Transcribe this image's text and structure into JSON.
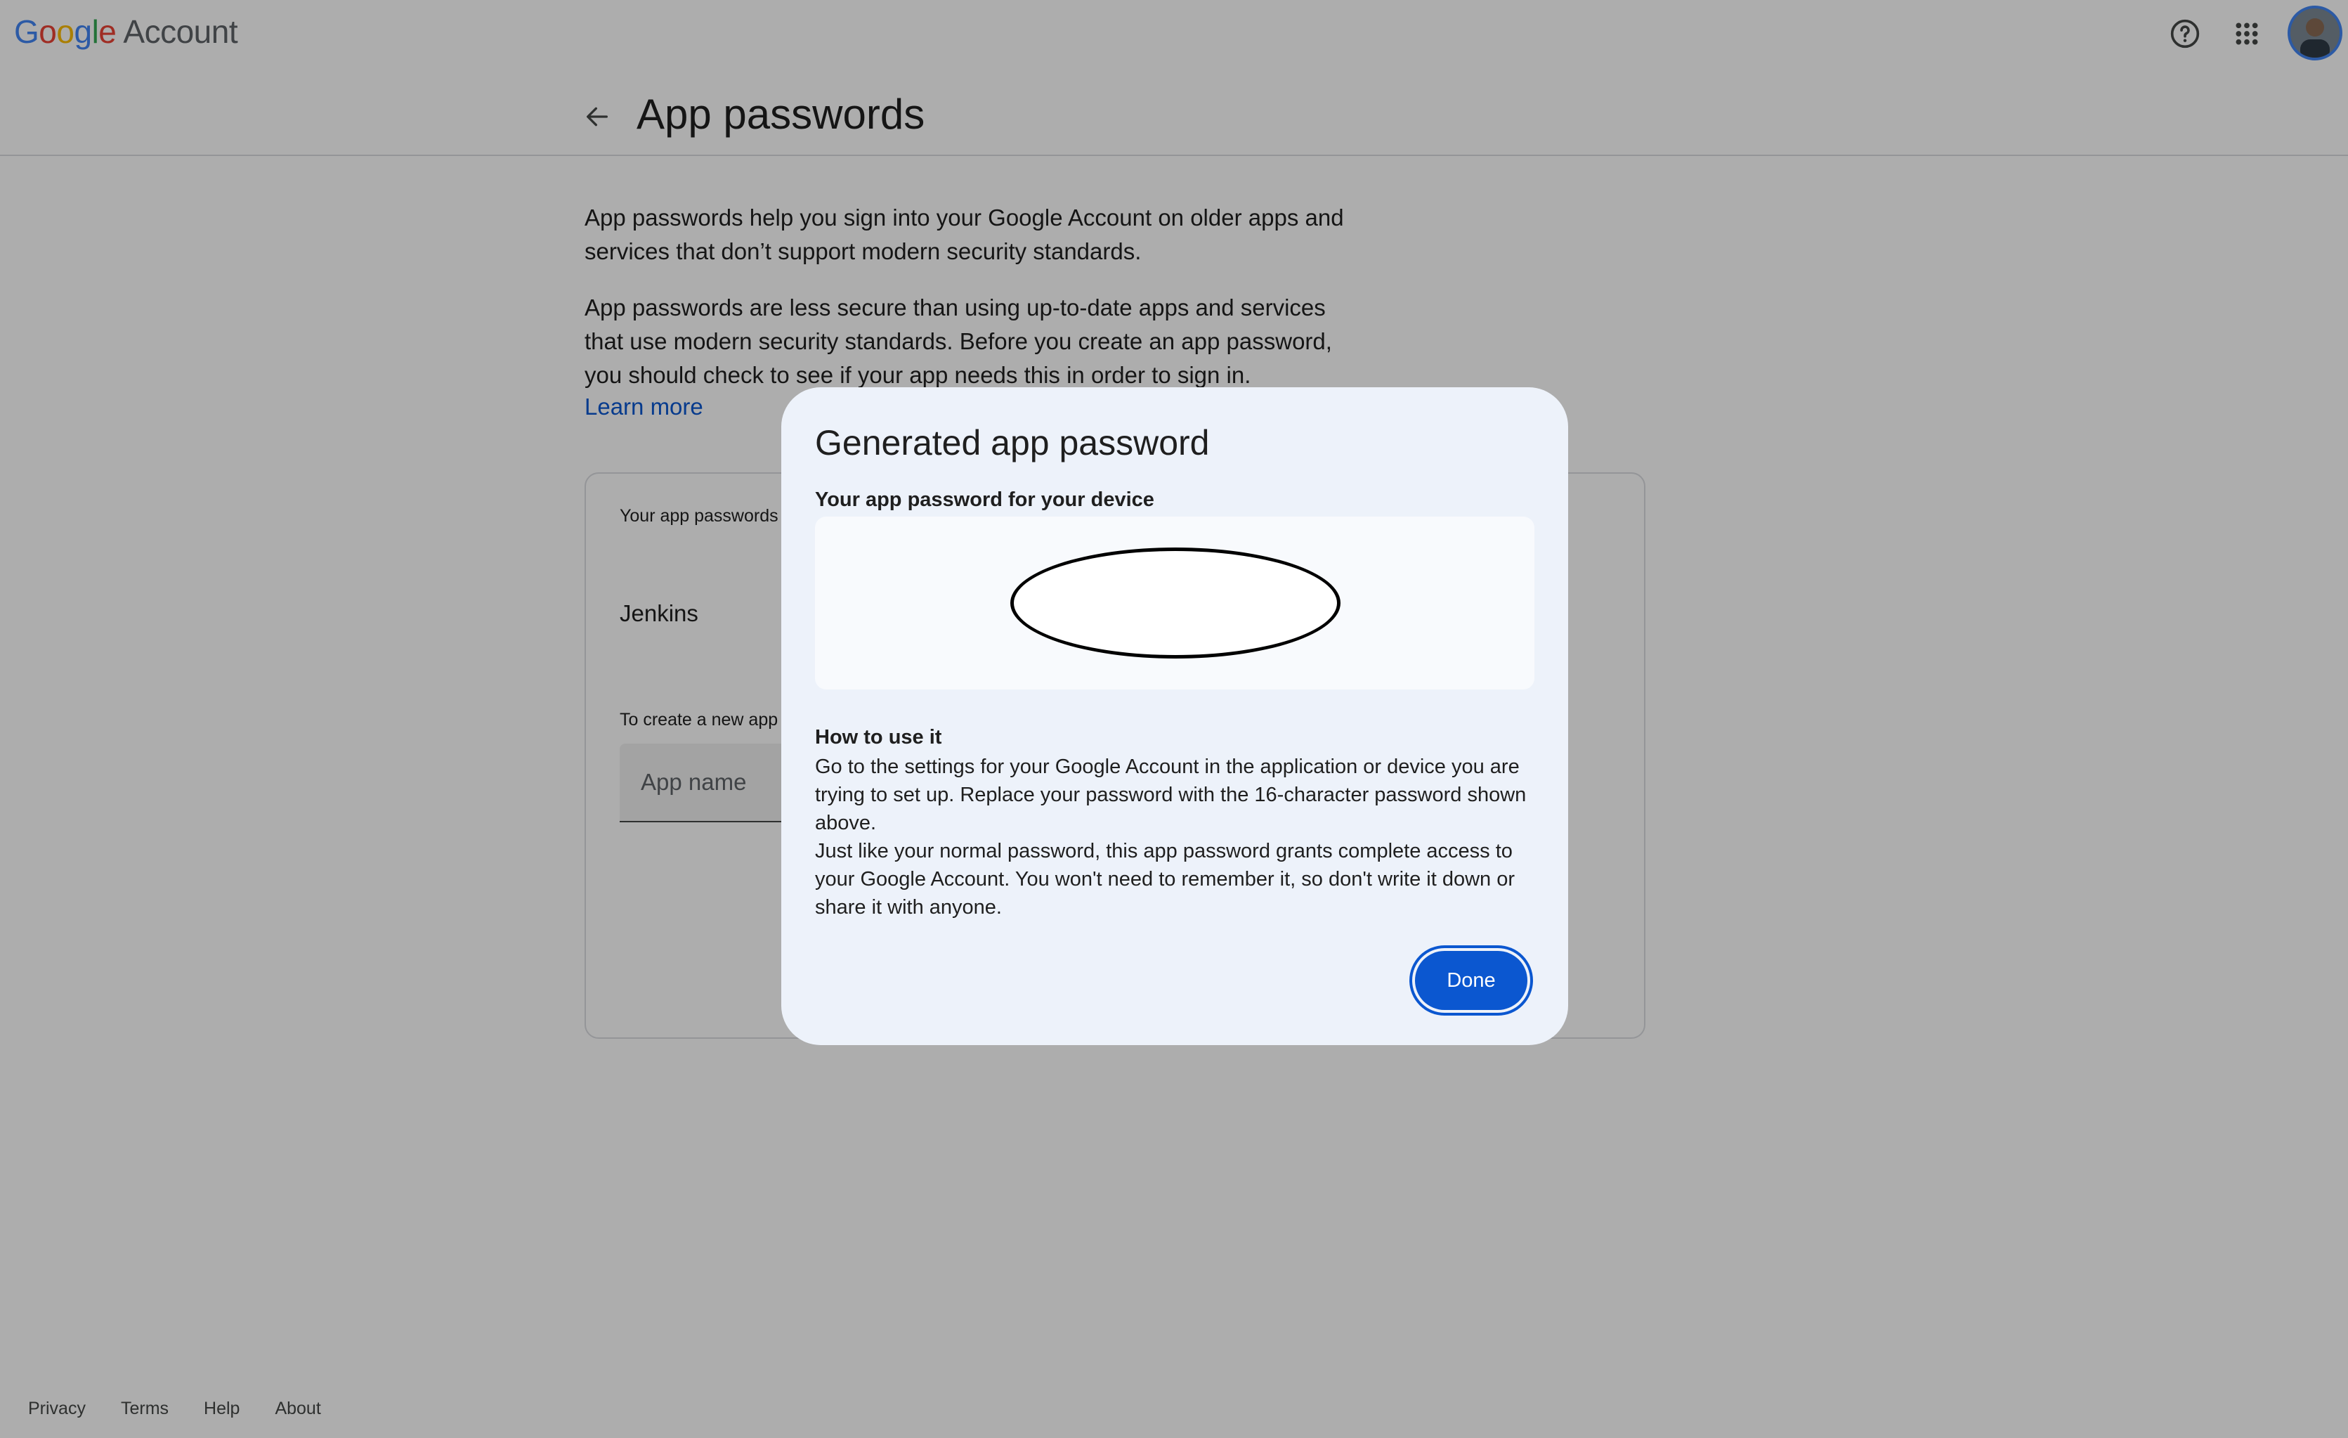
{
  "header": {
    "logo_letters": [
      "G",
      "o",
      "o",
      "g",
      "l",
      "e"
    ],
    "logo_product": "Account",
    "icons": [
      "help-circle-icon",
      "apps-grid-icon"
    ]
  },
  "title_bar": {
    "title": "App passwords"
  },
  "intro": {
    "p1": "App passwords help you sign into your Google Account on older apps and services that don’t support modern security standards.",
    "p2": "App passwords are less secure than using up-to-date apps and services that use modern security standards. Before you create an app password, you should check to see if your app needs this in order to sign in.",
    "learn_more": "Learn more"
  },
  "card": {
    "label": "Your app passwords",
    "apps": [
      "Jenkins"
    ],
    "create_label": "To create a new app",
    "app_name_placeholder": "App name"
  },
  "dialog": {
    "title": "Generated app password",
    "subtitle": "Your app password for your device",
    "how_title": "How to use it",
    "how_p1": "Go to the settings for your Google Account in the application or device you are trying to set up. Replace your password with the 16-character password shown above.",
    "how_p2": "Just like your normal password, this app password grants complete access to your Google Account. You won't need to remember it, so don't write it down or share it with anyone.",
    "done": "Done"
  },
  "footer": {
    "links": [
      "Privacy",
      "Terms",
      "Help",
      "About"
    ]
  },
  "colors": {
    "accent": "#0b57d0",
    "dialog_bg": "#edf2fa",
    "scrim": "rgba(0,0,0,0.32)"
  }
}
